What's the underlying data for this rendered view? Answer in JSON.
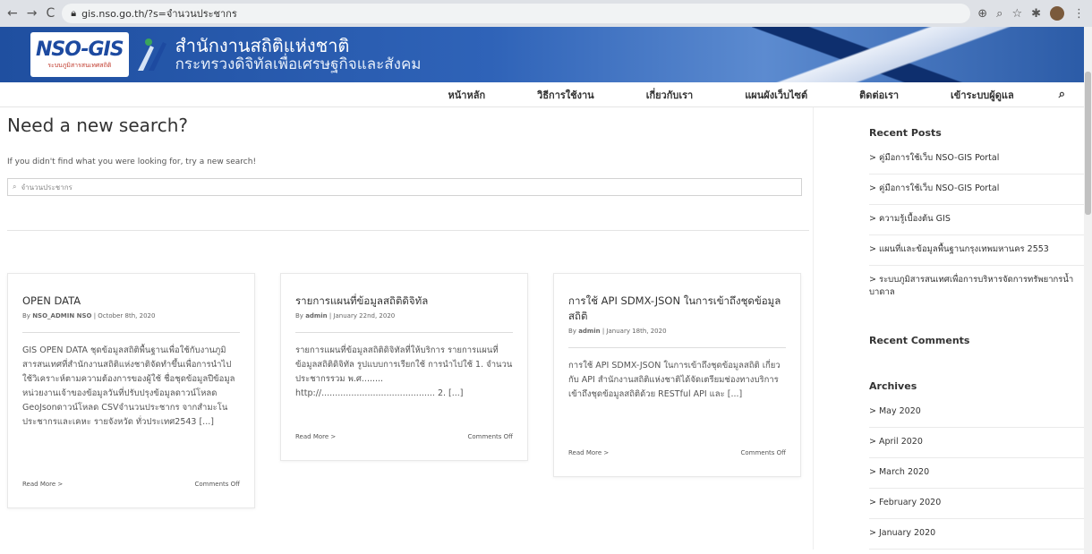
{
  "browser": {
    "url": "gis.nso.go.th/?s=จำนวนประชากร",
    "nav_back": "←",
    "nav_forward": "→",
    "nav_reload": "C"
  },
  "header": {
    "logo_text": "NSO-GIS",
    "logo_sub": "ระบบภูมิสารสนเทศสถิติ",
    "title_line1": "สำนักงานสถิติแห่งชาติ",
    "title_line2": "กระทรวงดิจิทัลเพื่อเศรษฐกิจและสังคม"
  },
  "menu": {
    "items": [
      "หน้าหลัก",
      "วิธีการใช้งาน",
      "เกี่ยวกับเรา",
      "แผนผังเว็บไซต์",
      "ติดต่อเรา",
      "เข้าระบบผู้ดูแล"
    ]
  },
  "search": {
    "heading": "Need a new search?",
    "hint": "If you didn't find what you were looking for, try a new search!",
    "value": "จำนวนประชากร"
  },
  "cards": [
    {
      "title": "OPEN DATA",
      "by_prefix": "By",
      "author": "NSO_ADMIN NSO",
      "date": "October 8th, 2020",
      "excerpt": "GIS OPEN DATA ชุดข้อมูลสถิติพื้นฐานเพื่อใช้กับงานภูมิสารสนเทศที่สำนักงานสถิติแห่งชาติจัดทำขึ้นเพื่อการนำไปใช้วิเคราะห์ตามความต้องการของผู้ใช้ ชื่อชุดข้อมูลปีข้อมูลหน่วยงานเจ้าของข้อมูลวันที่ปรับปรุงข้อมูลดาวน์โหลด GeoJsonดาวน์โหลด CSVจำนวนประชากร จากสำมะโนประชากรและเคหะ รายจังหวัด ทั่วประเทศ2543 [...]",
      "read_more": "Read More >",
      "comments": "Comments Off"
    },
    {
      "title": "รายการแผนที่ข้อมูลสถิติดิจิทัล",
      "by_prefix": "By",
      "author": "admin",
      "date": "January 22nd, 2020",
      "excerpt": "รายการแผนที่ข้อมูลสถิติดิจิทัลที่ให้บริการ รายการแผนที่ข้อมูลสถิติดิจิทัล รูปแบบการเรียกใช้ การนำไปใช้ 1. จำนวนประชากรรวม พ.ศ........ http://.......................................... 2. [...]",
      "read_more": "Read More >",
      "comments": "Comments Off"
    },
    {
      "title": "การใช้ API SDMX-JSON ในการเข้าถึงชุดข้อมูลสถิติ",
      "by_prefix": "By",
      "author": "admin",
      "date": "January 18th, 2020",
      "excerpt": "การใช้ API SDMX-JSON ในการเข้าถึงชุดข้อมูลสถิติ เกี่ยวกับ API สำนักงานสถิติแห่งชาติได้จัดเตรียมช่องทางบริการเข้าถึงชุดข้อมูลสถิติด้วย RESTful API และ [...]",
      "read_more": "Read More >",
      "comments": "Comments Off"
    }
  ],
  "sidebar": {
    "recent_posts_heading": "Recent Posts",
    "recent_posts": [
      "> คู่มือการใช้เว็บ NSO-GIS Portal",
      "> คู่มือการใช้เว็บ NSO-GIS Portal",
      "> ความรู้เบื้องต้น GIS",
      "> แผนที่และข้อมูลพื้นฐานกรุงเทพมหานคร 2553",
      "> ระบบภูมิสารสนเทศเพื่อการบริหารจัดการทรัพยากรน้ำบาดาล"
    ],
    "recent_comments_heading": "Recent Comments",
    "archives_heading": "Archives",
    "archives": [
      "> May 2020",
      "> April 2020",
      "> March 2020",
      "> February 2020",
      "> January 2020"
    ]
  }
}
